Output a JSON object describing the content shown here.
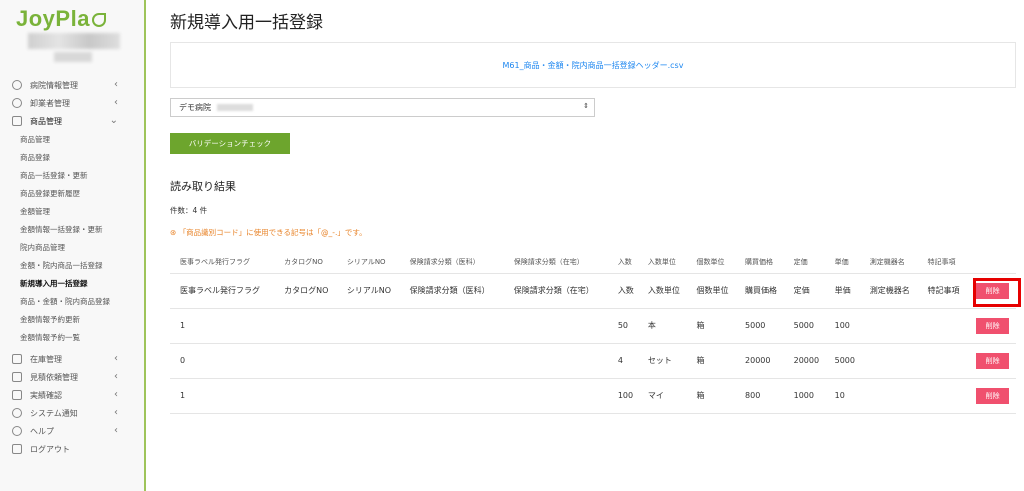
{
  "brand": "JoyPla",
  "sidebar": {
    "items": [
      {
        "label": "病院情報管理",
        "icon": "users-icon",
        "chevron": "‹"
      },
      {
        "label": "卸業者管理",
        "icon": "users-icon",
        "chevron": "‹"
      },
      {
        "label": "商品管理",
        "icon": "box-icon",
        "chevron": "⌄"
      }
    ],
    "subitems": [
      "商品管理",
      "商品登録",
      "商品一括登録・更新",
      "商品登録更新履歴",
      "金額管理",
      "金額情報一括登録・更新",
      "院内商品管理",
      "金額・院内商品一括登録",
      "新規導入用一括登録",
      "商品・金額・院内商品登録",
      "金額情報予約更新",
      "金額情報予約一覧"
    ],
    "bottom_items": [
      {
        "label": "在庫管理",
        "icon": "database-icon",
        "chevron": "‹"
      },
      {
        "label": "見積依頼管理",
        "icon": "printer-icon",
        "chevron": "‹"
      },
      {
        "label": "実績確認",
        "icon": "edit-icon",
        "chevron": "‹"
      },
      {
        "label": "システム通知",
        "icon": "info-icon",
        "chevron": "‹"
      },
      {
        "label": "ヘルプ",
        "icon": "question-icon",
        "chevron": "‹"
      },
      {
        "label": "ログアウト",
        "icon": "signout-icon",
        "chevron": ""
      }
    ]
  },
  "main": {
    "title": "新規導入用一括登録",
    "file_link": "M61_商品・金額・院内商品一括登録ヘッダー.csv",
    "select_value": "デモ病院",
    "validate_label": "バリデーションチェック",
    "results_title": "読み取り結果",
    "count": "件数：4 件",
    "warning": "「商品識別コード」に使用できる記号は「@_-.」です。",
    "headers": [
      "医事ラベル発行フラグ",
      "カタログNO",
      "シリアルNO",
      "保険請求分類（医科）",
      "保険請求分類（在宅）",
      "入数",
      "入数単位",
      "個数単位",
      "購買価格",
      "定価",
      "単価",
      "測定機器名",
      "特記事項"
    ],
    "rows": [
      [
        "医事ラベル発行フラグ",
        "カタログNO",
        "シリアルNO",
        "保険請求分類（医科）",
        "保険請求分類（在宅）",
        "入数",
        "入数単位",
        "個数単位",
        "購買価格",
        "定価",
        "単価",
        "測定機器名",
        "特記事項"
      ],
      [
        "1",
        "",
        "",
        "",
        "",
        "50",
        "本",
        "箱",
        "5000",
        "5000",
        "100",
        "",
        ""
      ],
      [
        "0",
        "",
        "",
        "",
        "",
        "4",
        "セット",
        "箱",
        "20000",
        "20000",
        "5000",
        "",
        ""
      ],
      [
        "1",
        "",
        "",
        "",
        "",
        "100",
        "マイ",
        "箱",
        "800",
        "1000",
        "10",
        "",
        ""
      ]
    ],
    "delete_label": "削除"
  }
}
